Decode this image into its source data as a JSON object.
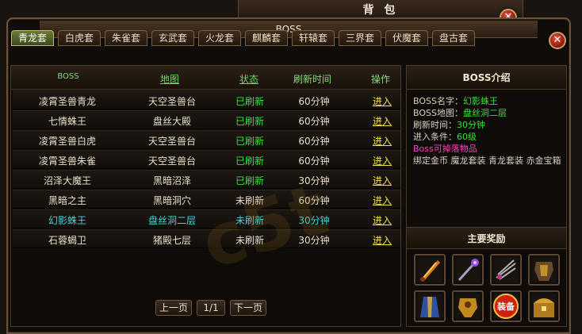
{
  "bag": {
    "title": "背 包"
  },
  "window": {
    "title": "BOSS"
  },
  "tabs": [
    {
      "label": "青龙套",
      "active": true
    },
    {
      "label": "白虎套"
    },
    {
      "label": "朱雀套"
    },
    {
      "label": "玄武套"
    },
    {
      "label": "火龙套"
    },
    {
      "label": "麒麟套"
    },
    {
      "label": "轩辕套"
    },
    {
      "label": "三界套"
    },
    {
      "label": "伏魔套"
    },
    {
      "label": "盘古套"
    }
  ],
  "table": {
    "headers": {
      "boss": "BOSS",
      "map": "地图",
      "status": "状态",
      "refresh": "刷新时间",
      "op": "操作"
    },
    "rows": [
      {
        "name": "凌霄圣兽青龙",
        "map": "天空圣兽台",
        "status": "已刷新",
        "time": "60分钟",
        "op": "进入",
        "style": "normal"
      },
      {
        "name": "七情蛛王",
        "map": "盘丝大殿",
        "status": "已刷新",
        "time": "60分钟",
        "op": "进入",
        "style": "normal"
      },
      {
        "name": "凌霄圣兽白虎",
        "map": "天空圣兽台",
        "status": "已刷新",
        "time": "60分钟",
        "op": "进入",
        "style": "normal"
      },
      {
        "name": "凌霄圣兽朱雀",
        "map": "天空圣兽台",
        "status": "已刷新",
        "time": "60分钟",
        "op": "进入",
        "style": "normal"
      },
      {
        "name": "沼泽大魔王",
        "map": "黑暗沼泽",
        "status": "已刷新",
        "time": "30分钟",
        "op": "进入",
        "style": "normal"
      },
      {
        "name": "黑暗之主",
        "map": "黑暗洞穴",
        "status": "未刷新",
        "time": "60分钟",
        "op": "进入",
        "style": "normal"
      },
      {
        "name": "幻影蛛王",
        "map": "盘丝洞二层",
        "status": "未刷新",
        "time": "30分钟",
        "op": "进入",
        "style": "selected"
      },
      {
        "name": "石蓉蝎卫",
        "map": "猪殿七层",
        "status": "未刷新",
        "time": "30分钟",
        "op": "进入",
        "style": "normal"
      }
    ]
  },
  "pager": {
    "prev": "上一页",
    "page": "1/1",
    "next": "下一页"
  },
  "boss_info": {
    "title": "BOSS介绍",
    "name_label": "BOSS名字：",
    "name_value": "幻影蛛王",
    "map_label": "BOSS地图：",
    "map_value": "盘丝洞二层",
    "refresh_label": "刷新时间：",
    "refresh_value": "30分钟",
    "condition_label": "进入条件：",
    "condition_value": "60级",
    "drop_title": "Boss可掉落物品",
    "drop_text": "绑定金币 魔龙套装 青龙套装 赤金宝箱"
  },
  "rewards": {
    "title": "主要奖励",
    "items": [
      {
        "icon": "flame-sword-icon"
      },
      {
        "icon": "magic-staff-icon"
      },
      {
        "icon": "claw-blade-icon"
      },
      {
        "icon": "dark-armor-icon"
      },
      {
        "icon": "blue-robe-icon"
      },
      {
        "icon": "gold-armor-icon"
      },
      {
        "icon": "equipment-badge-icon",
        "text": "装备"
      },
      {
        "icon": "treasure-chest-icon"
      }
    ]
  },
  "watermark": "c5t"
}
